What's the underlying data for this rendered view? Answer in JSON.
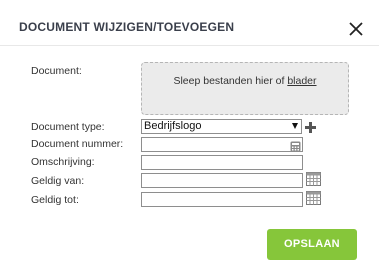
{
  "dialog": {
    "title": "DOCUMENT WIJZIGEN/TOEVOEGEN",
    "close_icon": "close-icon"
  },
  "form": {
    "document_label": "Document:",
    "dropzone_text": "Sleep bestanden hier of",
    "dropzone_link": "blader",
    "document_type_label": "Document type:",
    "document_type_value": "Bedrijfslogo",
    "document_number_label": "Document nummer:",
    "document_number_value": "",
    "description_label": "Omschrijving:",
    "description_value": "",
    "valid_from_label": "Geldig van:",
    "valid_from_value": "",
    "valid_to_label": "Geldig tot:",
    "valid_to_value": ""
  },
  "actions": {
    "save_label": "OPSLAAN"
  },
  "colors": {
    "accent": "#86c63a",
    "title": "#3a3f4b",
    "dropzone_bg": "#ebebeb"
  },
  "icons": {
    "add": "plus-icon",
    "calculator": "calculator-icon",
    "calendar": "calendar-icon"
  }
}
